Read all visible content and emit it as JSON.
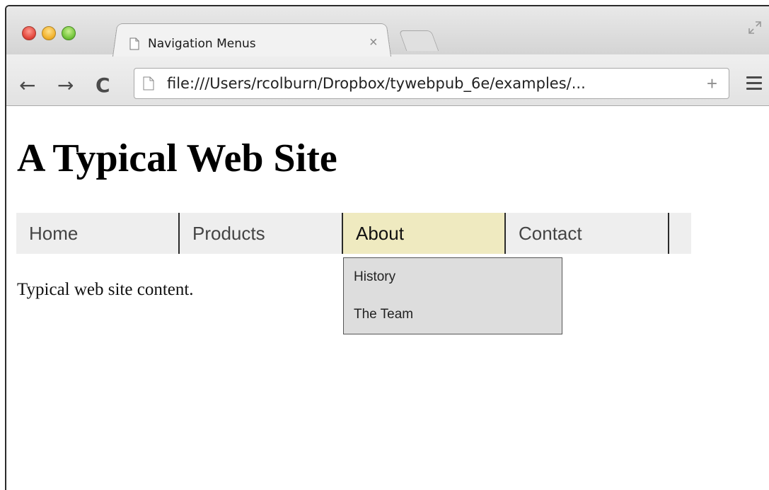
{
  "browser": {
    "tab_title": "Navigation Menus",
    "tab_close": "×",
    "url": "file:///Users/rcolburn/Dropbox/tywebpub_6e/examples/...",
    "add_bookmark": "+",
    "back": "←",
    "forward": "→",
    "reload": "C"
  },
  "page": {
    "title": "A Typical Web Site",
    "nav": {
      "home": "Home",
      "products": "Products",
      "about": "About",
      "contact": "Contact"
    },
    "dropdown": {
      "history": "History",
      "team": "The Team"
    },
    "body_text": "Typical web site content."
  },
  "colors": {
    "nav_background": "#eeeeee",
    "nav_active": "#efeac0",
    "dropdown_background": "#dddddd"
  }
}
